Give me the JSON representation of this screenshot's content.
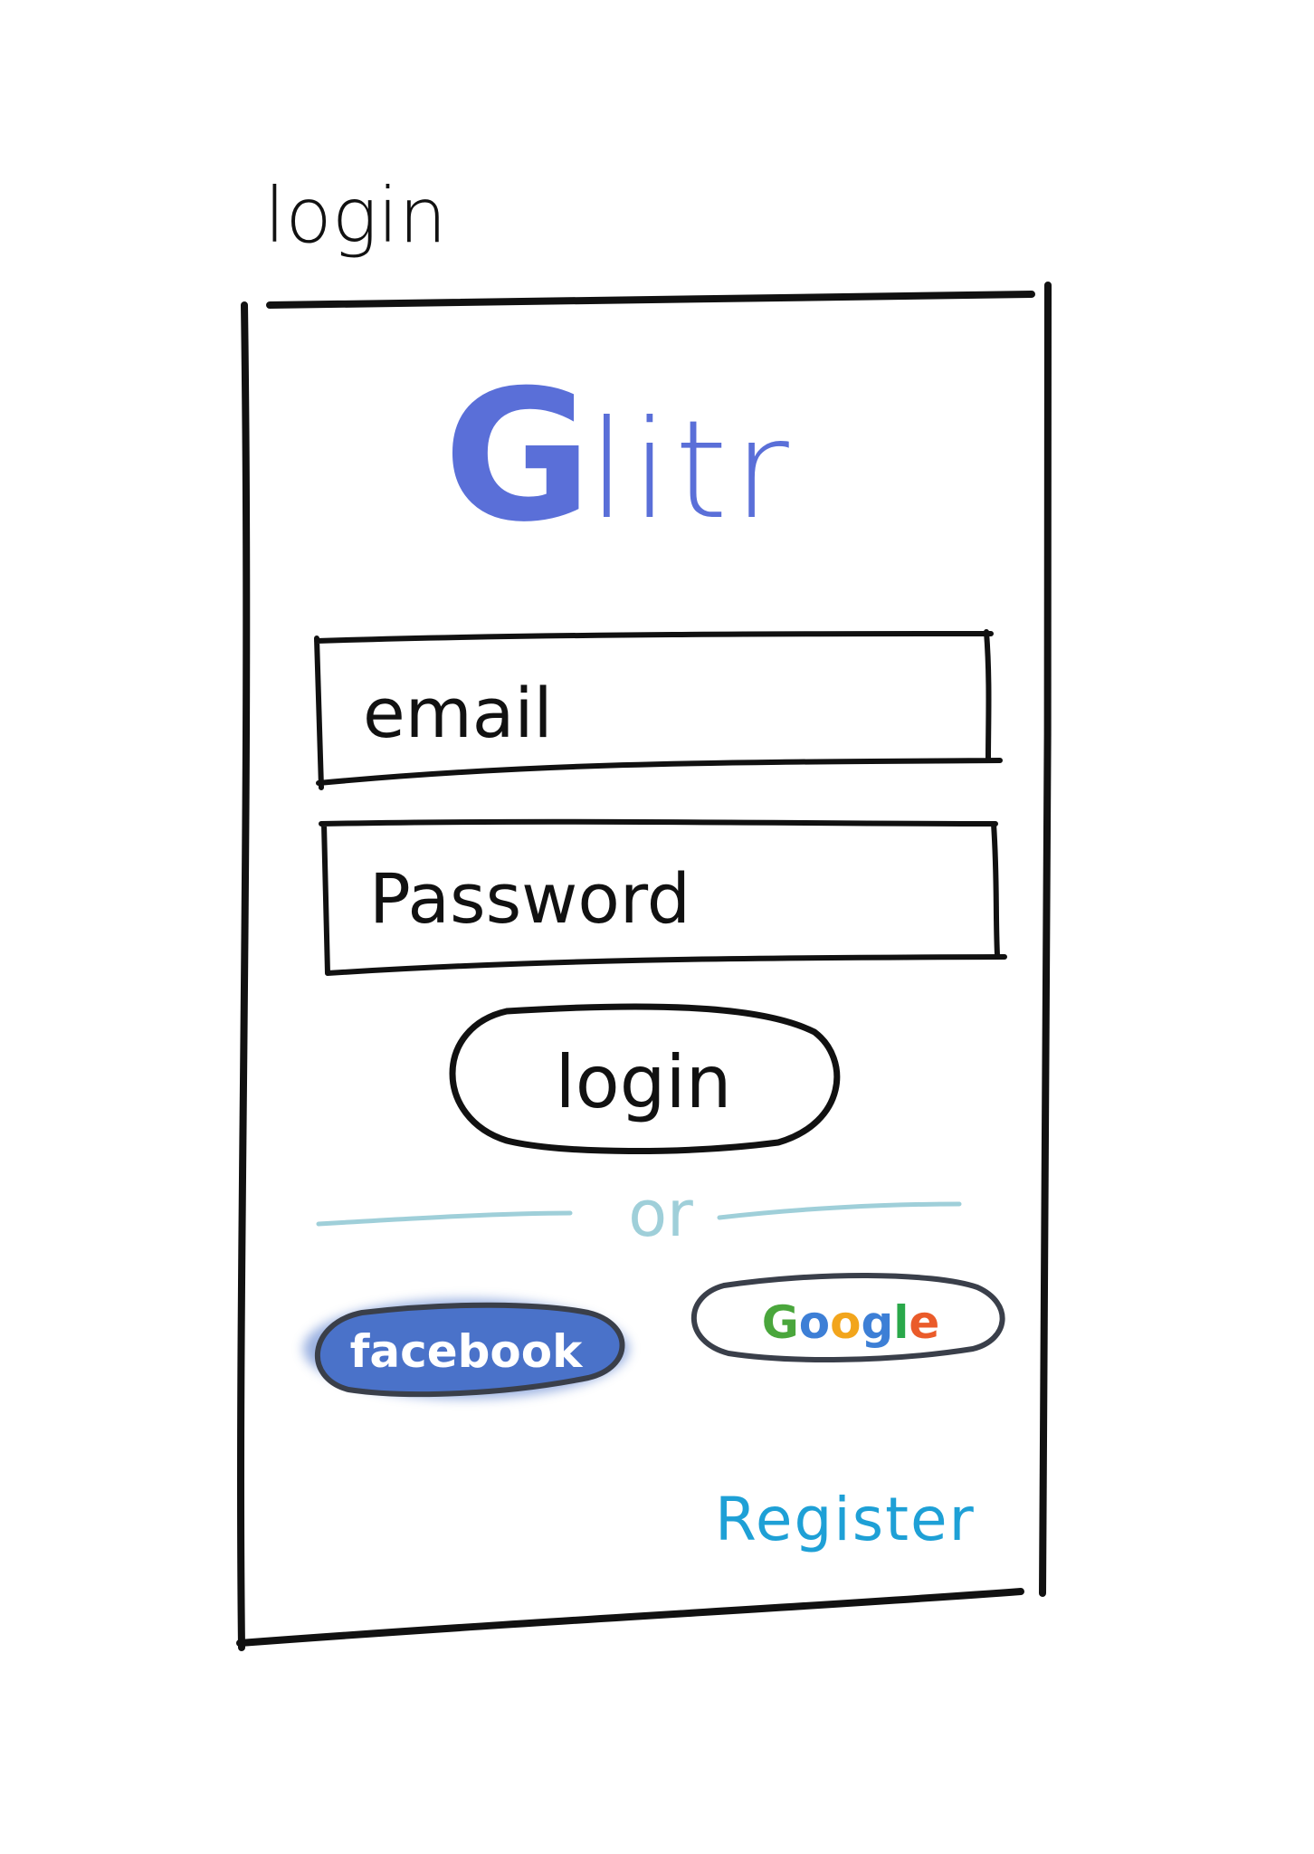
{
  "screen": {
    "title": "login"
  },
  "logo": {
    "initial": "G",
    "rest": "litr",
    "color": "#5a6fd8"
  },
  "form": {
    "email_placeholder": "email",
    "password_placeholder": "Password",
    "login_label": "login"
  },
  "divider": {
    "label": "or",
    "color": "#9fcfd9"
  },
  "social": {
    "facebook_label": "facebook",
    "facebook_color": "#4a72c9",
    "google_letters": [
      "G",
      "o",
      "o",
      "g",
      "l",
      "e"
    ],
    "google_colors": [
      "#4aa63c",
      "#3d7fd6",
      "#f2a51c",
      "#3d7fd6",
      "#2aa84a",
      "#ea5b2a"
    ]
  },
  "register": {
    "label": "Register",
    "color": "#1ea0d6"
  }
}
